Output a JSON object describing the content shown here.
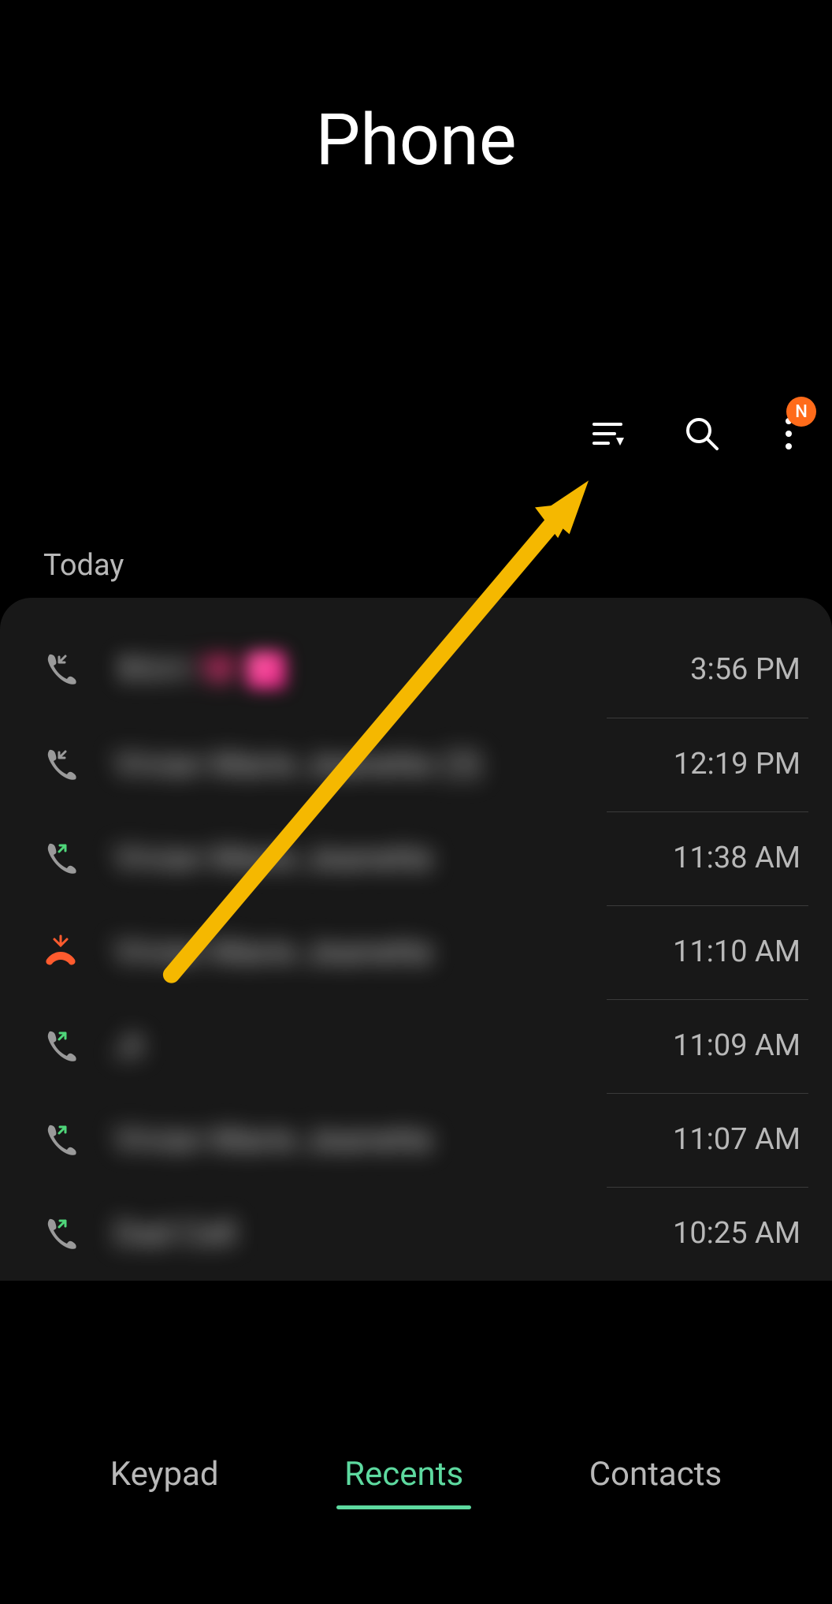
{
  "header": {
    "title": "Phone"
  },
  "toolbar": {
    "filter_icon": "filter",
    "search_icon": "search",
    "menu_icon": "more",
    "badge_text": "N"
  },
  "section": {
    "label": "Today"
  },
  "calls": [
    {
      "type": "incoming",
      "name": "Mom 💗",
      "time": "3:56 PM",
      "has_heart": true
    },
    {
      "type": "incoming",
      "name": "Vivian Marie Jeanette (3)",
      "time": "12:19 PM"
    },
    {
      "type": "outgoing",
      "name": "Vivian Marie Jeanette",
      "time": "11:38 AM"
    },
    {
      "type": "missed",
      "name": "Vivian Marie Jeanette",
      "time": "11:10 AM"
    },
    {
      "type": "outgoing",
      "name": "Jt",
      "time": "11:09 AM"
    },
    {
      "type": "outgoing",
      "name": "Vivian Marie Jeanette",
      "time": "11:07 AM"
    },
    {
      "type": "outgoing",
      "name": "Dad Cell",
      "time": "10:25 AM"
    }
  ],
  "nav": {
    "items": [
      {
        "label": "Keypad",
        "active": false
      },
      {
        "label": "Recents",
        "active": true
      },
      {
        "label": "Contacts",
        "active": false
      }
    ]
  }
}
